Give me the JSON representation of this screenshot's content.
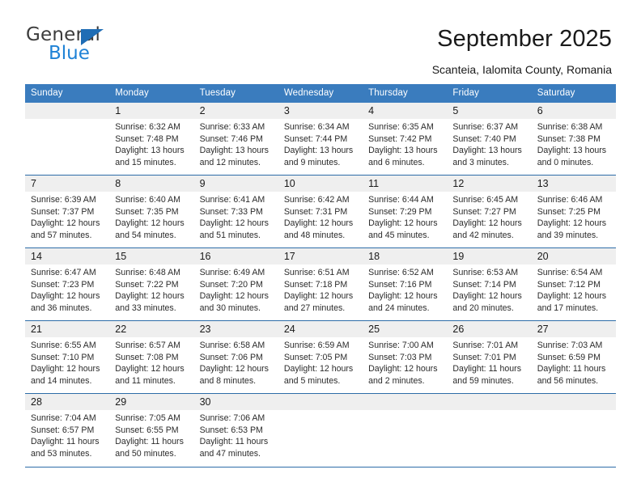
{
  "brand": {
    "line1": "General",
    "line2": "Blue",
    "triangle_color": "#1f6db5",
    "blue_color": "#1f82d6"
  },
  "header": {
    "title": "September 2025",
    "subtitle": "Scanteia, Ialomita County, Romania"
  },
  "theme": {
    "header_bg": "#3a7cbe",
    "daynum_bg": "#efefef",
    "rule_color": "#2d6ca8"
  },
  "weekday_headers": [
    "Sunday",
    "Monday",
    "Tuesday",
    "Wednesday",
    "Thursday",
    "Friday",
    "Saturday"
  ],
  "weeks": [
    [
      {
        "day": "",
        "sunrise": "",
        "sunset": "",
        "daylight1": "",
        "daylight2": ""
      },
      {
        "day": "1",
        "sunrise": "Sunrise: 6:32 AM",
        "sunset": "Sunset: 7:48 PM",
        "daylight1": "Daylight: 13 hours",
        "daylight2": "and 15 minutes."
      },
      {
        "day": "2",
        "sunrise": "Sunrise: 6:33 AM",
        "sunset": "Sunset: 7:46 PM",
        "daylight1": "Daylight: 13 hours",
        "daylight2": "and 12 minutes."
      },
      {
        "day": "3",
        "sunrise": "Sunrise: 6:34 AM",
        "sunset": "Sunset: 7:44 PM",
        "daylight1": "Daylight: 13 hours",
        "daylight2": "and 9 minutes."
      },
      {
        "day": "4",
        "sunrise": "Sunrise: 6:35 AM",
        "sunset": "Sunset: 7:42 PM",
        "daylight1": "Daylight: 13 hours",
        "daylight2": "and 6 minutes."
      },
      {
        "day": "5",
        "sunrise": "Sunrise: 6:37 AM",
        "sunset": "Sunset: 7:40 PM",
        "daylight1": "Daylight: 13 hours",
        "daylight2": "and 3 minutes."
      },
      {
        "day": "6",
        "sunrise": "Sunrise: 6:38 AM",
        "sunset": "Sunset: 7:38 PM",
        "daylight1": "Daylight: 13 hours",
        "daylight2": "and 0 minutes."
      }
    ],
    [
      {
        "day": "7",
        "sunrise": "Sunrise: 6:39 AM",
        "sunset": "Sunset: 7:37 PM",
        "daylight1": "Daylight: 12 hours",
        "daylight2": "and 57 minutes."
      },
      {
        "day": "8",
        "sunrise": "Sunrise: 6:40 AM",
        "sunset": "Sunset: 7:35 PM",
        "daylight1": "Daylight: 12 hours",
        "daylight2": "and 54 minutes."
      },
      {
        "day": "9",
        "sunrise": "Sunrise: 6:41 AM",
        "sunset": "Sunset: 7:33 PM",
        "daylight1": "Daylight: 12 hours",
        "daylight2": "and 51 minutes."
      },
      {
        "day": "10",
        "sunrise": "Sunrise: 6:42 AM",
        "sunset": "Sunset: 7:31 PM",
        "daylight1": "Daylight: 12 hours",
        "daylight2": "and 48 minutes."
      },
      {
        "day": "11",
        "sunrise": "Sunrise: 6:44 AM",
        "sunset": "Sunset: 7:29 PM",
        "daylight1": "Daylight: 12 hours",
        "daylight2": "and 45 minutes."
      },
      {
        "day": "12",
        "sunrise": "Sunrise: 6:45 AM",
        "sunset": "Sunset: 7:27 PM",
        "daylight1": "Daylight: 12 hours",
        "daylight2": "and 42 minutes."
      },
      {
        "day": "13",
        "sunrise": "Sunrise: 6:46 AM",
        "sunset": "Sunset: 7:25 PM",
        "daylight1": "Daylight: 12 hours",
        "daylight2": "and 39 minutes."
      }
    ],
    [
      {
        "day": "14",
        "sunrise": "Sunrise: 6:47 AM",
        "sunset": "Sunset: 7:23 PM",
        "daylight1": "Daylight: 12 hours",
        "daylight2": "and 36 minutes."
      },
      {
        "day": "15",
        "sunrise": "Sunrise: 6:48 AM",
        "sunset": "Sunset: 7:22 PM",
        "daylight1": "Daylight: 12 hours",
        "daylight2": "and 33 minutes."
      },
      {
        "day": "16",
        "sunrise": "Sunrise: 6:49 AM",
        "sunset": "Sunset: 7:20 PM",
        "daylight1": "Daylight: 12 hours",
        "daylight2": "and 30 minutes."
      },
      {
        "day": "17",
        "sunrise": "Sunrise: 6:51 AM",
        "sunset": "Sunset: 7:18 PM",
        "daylight1": "Daylight: 12 hours",
        "daylight2": "and 27 minutes."
      },
      {
        "day": "18",
        "sunrise": "Sunrise: 6:52 AM",
        "sunset": "Sunset: 7:16 PM",
        "daylight1": "Daylight: 12 hours",
        "daylight2": "and 24 minutes."
      },
      {
        "day": "19",
        "sunrise": "Sunrise: 6:53 AM",
        "sunset": "Sunset: 7:14 PM",
        "daylight1": "Daylight: 12 hours",
        "daylight2": "and 20 minutes."
      },
      {
        "day": "20",
        "sunrise": "Sunrise: 6:54 AM",
        "sunset": "Sunset: 7:12 PM",
        "daylight1": "Daylight: 12 hours",
        "daylight2": "and 17 minutes."
      }
    ],
    [
      {
        "day": "21",
        "sunrise": "Sunrise: 6:55 AM",
        "sunset": "Sunset: 7:10 PM",
        "daylight1": "Daylight: 12 hours",
        "daylight2": "and 14 minutes."
      },
      {
        "day": "22",
        "sunrise": "Sunrise: 6:57 AM",
        "sunset": "Sunset: 7:08 PM",
        "daylight1": "Daylight: 12 hours",
        "daylight2": "and 11 minutes."
      },
      {
        "day": "23",
        "sunrise": "Sunrise: 6:58 AM",
        "sunset": "Sunset: 7:06 PM",
        "daylight1": "Daylight: 12 hours",
        "daylight2": "and 8 minutes."
      },
      {
        "day": "24",
        "sunrise": "Sunrise: 6:59 AM",
        "sunset": "Sunset: 7:05 PM",
        "daylight1": "Daylight: 12 hours",
        "daylight2": "and 5 minutes."
      },
      {
        "day": "25",
        "sunrise": "Sunrise: 7:00 AM",
        "sunset": "Sunset: 7:03 PM",
        "daylight1": "Daylight: 12 hours",
        "daylight2": "and 2 minutes."
      },
      {
        "day": "26",
        "sunrise": "Sunrise: 7:01 AM",
        "sunset": "Sunset: 7:01 PM",
        "daylight1": "Daylight: 11 hours",
        "daylight2": "and 59 minutes."
      },
      {
        "day": "27",
        "sunrise": "Sunrise: 7:03 AM",
        "sunset": "Sunset: 6:59 PM",
        "daylight1": "Daylight: 11 hours",
        "daylight2": "and 56 minutes."
      }
    ],
    [
      {
        "day": "28",
        "sunrise": "Sunrise: 7:04 AM",
        "sunset": "Sunset: 6:57 PM",
        "daylight1": "Daylight: 11 hours",
        "daylight2": "and 53 minutes."
      },
      {
        "day": "29",
        "sunrise": "Sunrise: 7:05 AM",
        "sunset": "Sunset: 6:55 PM",
        "daylight1": "Daylight: 11 hours",
        "daylight2": "and 50 minutes."
      },
      {
        "day": "30",
        "sunrise": "Sunrise: 7:06 AM",
        "sunset": "Sunset: 6:53 PM",
        "daylight1": "Daylight: 11 hours",
        "daylight2": "and 47 minutes."
      },
      {
        "day": "",
        "sunrise": "",
        "sunset": "",
        "daylight1": "",
        "daylight2": ""
      },
      {
        "day": "",
        "sunrise": "",
        "sunset": "",
        "daylight1": "",
        "daylight2": ""
      },
      {
        "day": "",
        "sunrise": "",
        "sunset": "",
        "daylight1": "",
        "daylight2": ""
      },
      {
        "day": "",
        "sunrise": "",
        "sunset": "",
        "daylight1": "",
        "daylight2": ""
      }
    ]
  ]
}
